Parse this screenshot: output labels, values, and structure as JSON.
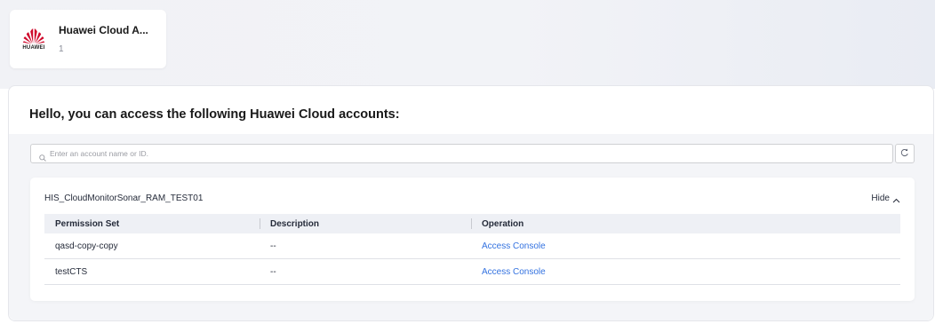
{
  "app_card": {
    "logo_word": "HUAWEI",
    "title": "Huawei Cloud A...",
    "count": "1"
  },
  "heading": "Hello, you can access the following Huawei Cloud accounts:",
  "search": {
    "placeholder": "Enter an account name or ID.",
    "value": ""
  },
  "account": {
    "name": "HIS_CloudMonitorSonar_RAM_TEST01",
    "toggle_label": "Hide"
  },
  "table": {
    "columns": [
      "Permission Set",
      "Description",
      "Operation"
    ],
    "rows": [
      {
        "permission_set": "qasd-copy-copy",
        "description": "--",
        "operation": "Access Console"
      },
      {
        "permission_set": "testCTS",
        "description": "--",
        "operation": "Access Console"
      }
    ]
  },
  "colors": {
    "link": "#3372e0",
    "logo_red": "#cf0a2c"
  },
  "icons": [
    "huawei-logo-icon",
    "search-icon",
    "refresh-icon",
    "chevron-up-icon"
  ]
}
